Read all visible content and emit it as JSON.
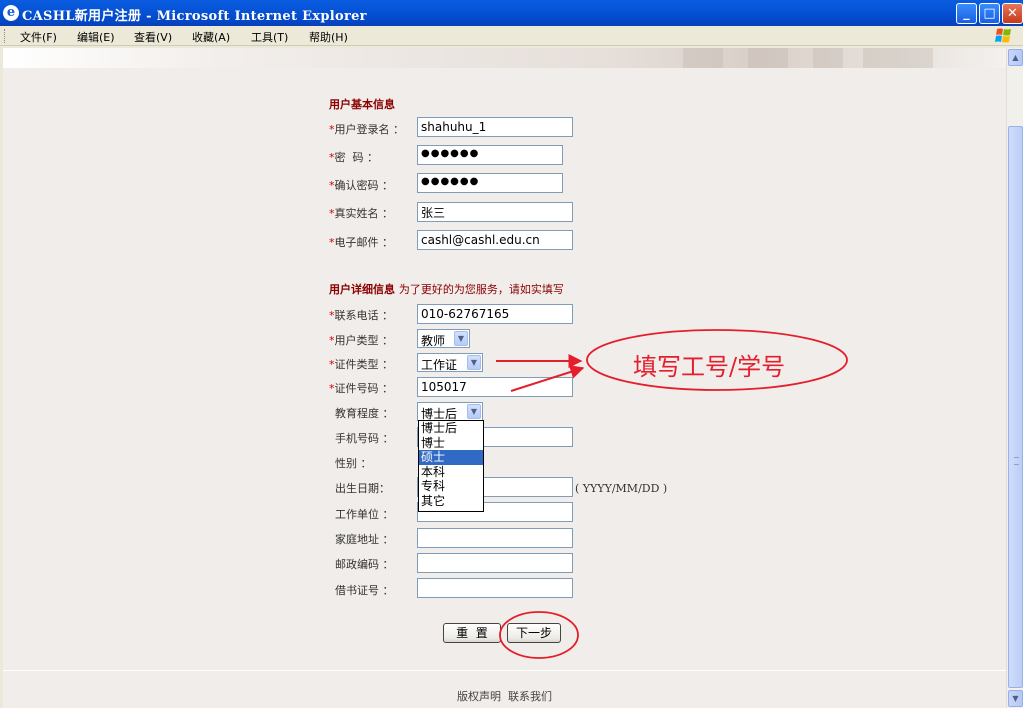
{
  "window": {
    "title": "CASHL新用户注册 - Microsoft Internet Explorer",
    "minimize_glyph": "_",
    "maximize_glyph": "□",
    "close_glyph": "✕"
  },
  "menu": {
    "items": [
      "文件(F)",
      "编辑(E)",
      "查看(V)",
      "收藏(A)",
      "工具(T)",
      "帮助(H)"
    ]
  },
  "form": {
    "basic_section_title": "用户基本信息",
    "required_marker": "*",
    "labels": {
      "username": "用户登录名 ：",
      "password": "密  码 ：",
      "confirm_password": "确认密码 ：",
      "real_name": "真实姓名 ：",
      "email": "电子邮件 ："
    },
    "values": {
      "username": "shahuhu_1",
      "password": "●●●●●●",
      "confirm_password": "●●●●●●",
      "real_name": "张三",
      "email": "cashl@cashl.edu.cn"
    },
    "detail_section_title": "用户详细信息",
    "detail_section_note": "为了更好的为您服务，请如实填写",
    "detail_labels": {
      "phone": "联系电话 ：",
      "user_type": "用户类型 ：",
      "id_type": "证件类型 ：",
      "id_number": "证件号码 ：",
      "education": "教育程度 ：",
      "mobile": "手机号码 ：",
      "gender": "性别 ：",
      "birth_date": "出生日期：",
      "work_unit": "工作单位 ：",
      "home_address": "家庭地址 ：",
      "postcode": "邮政编码 ：",
      "library_card": "借书证号 ："
    },
    "detail_values": {
      "phone": "010-62767165",
      "user_type": "教师",
      "id_type": "工作证",
      "id_number": "105017",
      "education": "博士后"
    },
    "education_options": [
      "博士后",
      "博士",
      "硕士",
      "本科",
      "专科",
      "其它"
    ],
    "education_highlighted": "硕士",
    "date_format_hint": "( YYYY/MM/DD )",
    "reset_label": "重  置",
    "next_label": "下一步"
  },
  "annotation": {
    "callout": "填写工号/学号",
    "color": "#E41E2B"
  },
  "footer": {
    "copyright": "版权声明",
    "contact": "联系我们"
  },
  "scrollbar": {
    "up_glyph": "▲",
    "down_glyph": "▼"
  }
}
